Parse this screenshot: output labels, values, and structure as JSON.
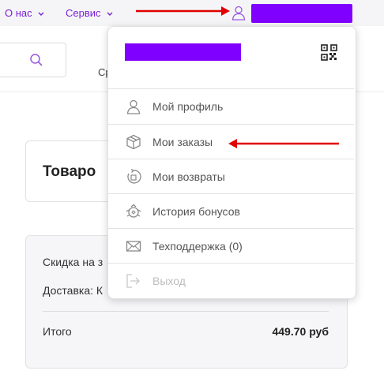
{
  "nav": {
    "about_label": "О нас",
    "service_label": "Сервис"
  },
  "background": {
    "partial_category": "Ср",
    "card_title": "Товаро",
    "discount_text": "Скидка на з",
    "delivery_text": "Доставка: К",
    "total_label": "Итого",
    "total_value": "449.70 руб"
  },
  "dropdown": {
    "items": [
      {
        "label": "Мой профиль",
        "icon": "user-icon"
      },
      {
        "label": "Мои заказы",
        "icon": "box-icon"
      },
      {
        "label": "Мои возвраты",
        "icon": "return-icon"
      },
      {
        "label": "История бонусов",
        "icon": "bonus-icon"
      },
      {
        "label": "Техподдержка (0)",
        "icon": "mail-icon"
      },
      {
        "label": "Выход",
        "icon": "logout-icon"
      }
    ]
  },
  "colors": {
    "accent": "#7f00ff",
    "nav_text": "#7a1fd6",
    "annotation_arrow": "#e00000"
  }
}
